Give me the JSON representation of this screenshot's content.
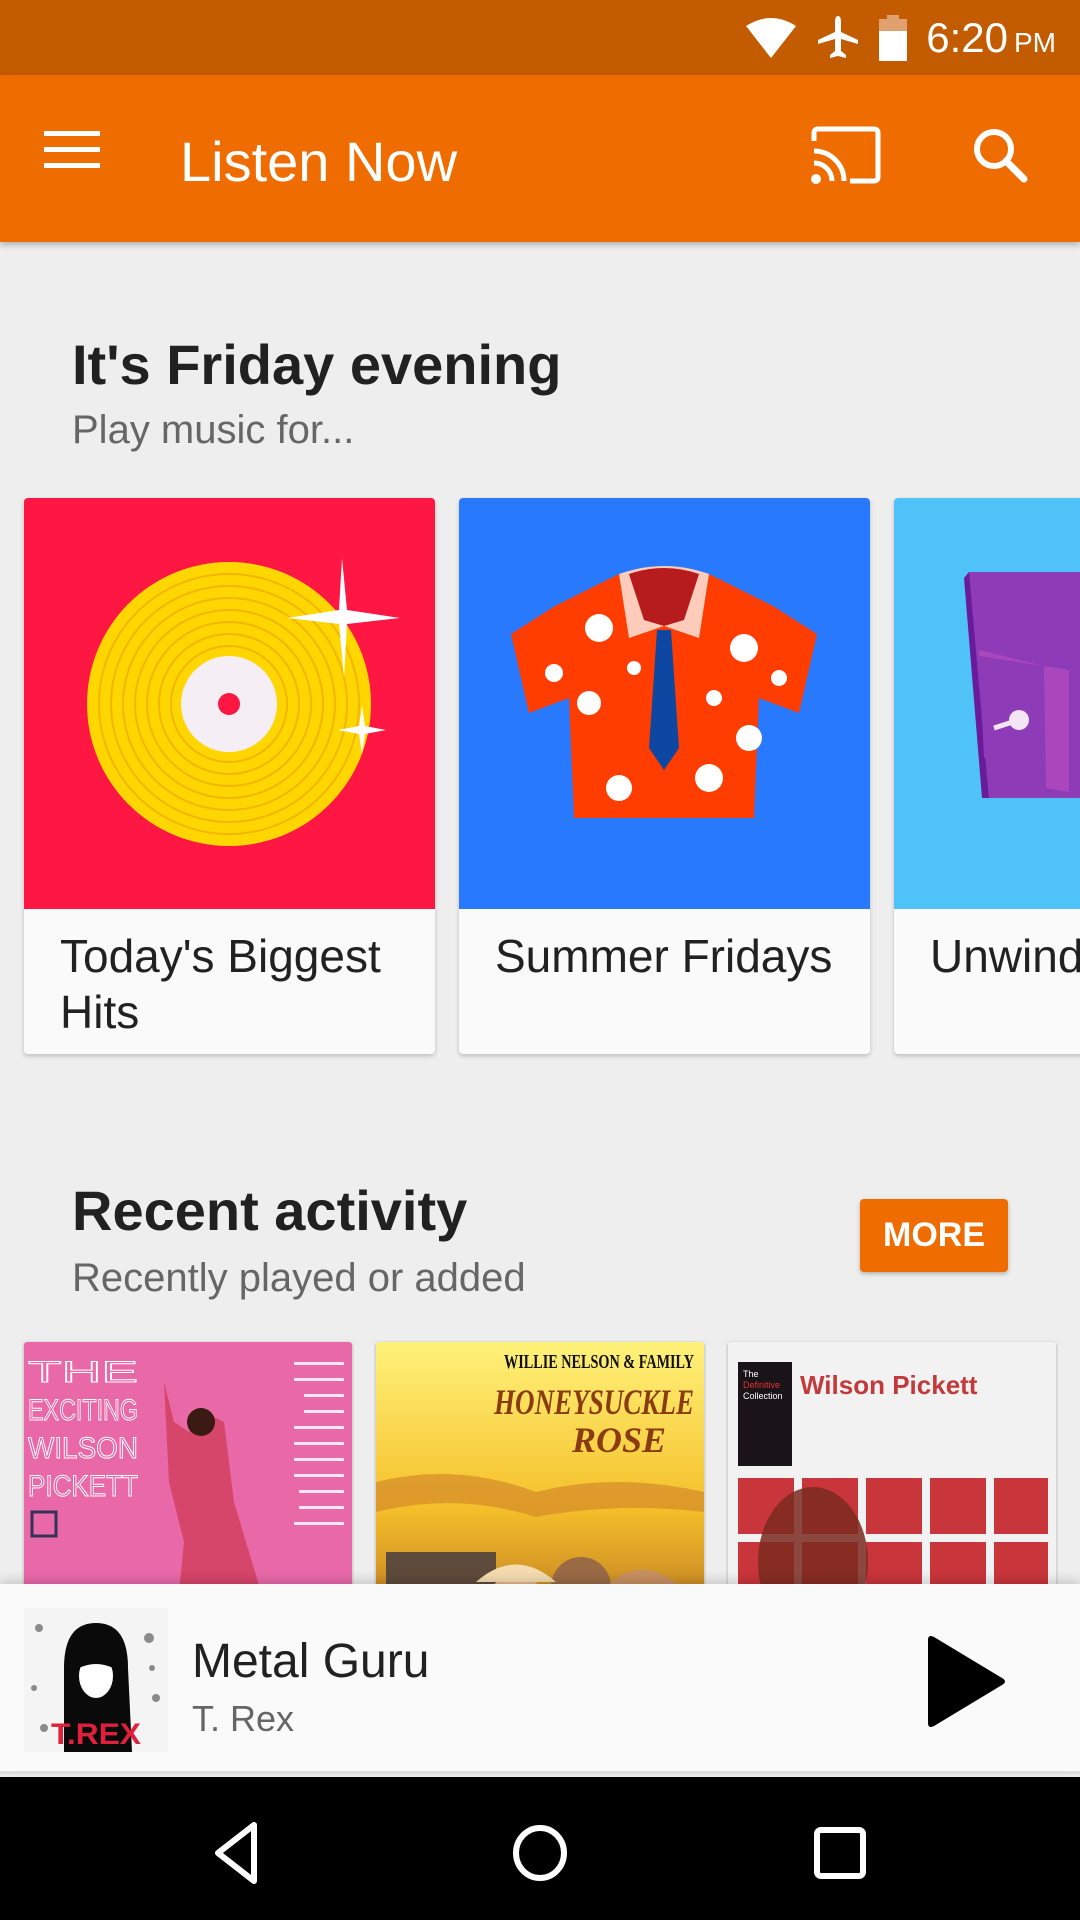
{
  "status_bar": {
    "time": "6:20",
    "ampm": "PM",
    "icons": [
      "wifi-icon",
      "airplane-mode-icon",
      "battery-icon"
    ]
  },
  "app_bar": {
    "title": "Listen Now",
    "icons": [
      "menu-icon",
      "cast-icon",
      "search-icon"
    ],
    "color": "#ef6c00"
  },
  "friday_section": {
    "title": "It's Friday evening",
    "subtitle": "Play music for...",
    "cards": [
      {
        "label": "Today's Biggest Hits",
        "art": "gold-record-illustration",
        "color": "#ff1744"
      },
      {
        "label": "Summer Fridays",
        "art": "hawaiian-shirt-illustration",
        "color": "#2979ff"
      },
      {
        "label": "Unwind",
        "art": "armchair-illustration",
        "color": "#4fc3f7"
      }
    ]
  },
  "recent_section": {
    "title": "Recent activity",
    "subtitle": "Recently played or added",
    "more_label": "MORE",
    "albums": [
      {
        "title_text": "THE EXCITING WILSON PICKETT",
        "artist": "Wilson Pickett"
      },
      {
        "title_text": "HONEYSUCKLE ROSE",
        "artist": "WILLIE NELSON & FAMILY"
      },
      {
        "title_text": "The Definitive Collection",
        "artist": "Wilson Pickett"
      }
    ]
  },
  "now_playing": {
    "title": "Metal Guru",
    "artist": "T. Rex",
    "art_text": "T.REX"
  },
  "nav_bar": {
    "buttons": [
      "back-icon",
      "home-icon",
      "recents-icon"
    ]
  }
}
